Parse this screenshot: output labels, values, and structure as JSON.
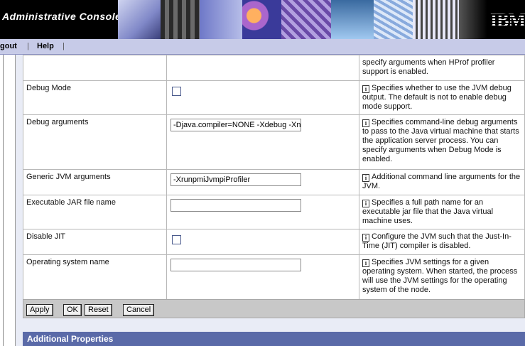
{
  "banner": {
    "title": "Administrative Console",
    "logo": "IBM"
  },
  "nav": {
    "items": [
      "gout",
      "Help"
    ]
  },
  "rows": [
    {
      "name": "",
      "type": "none",
      "value": "",
      "desc": "specify arguments when HProf profiler support is enabled.",
      "info": false
    },
    {
      "name": "Debug Mode",
      "type": "checkbox",
      "value": "",
      "desc": "Specifies whether to use the JVM debug output. The default is not to enable debug mode support.",
      "info": true
    },
    {
      "name": "Debug arguments",
      "type": "text",
      "value": "-Djava.compiler=NONE -Xdebug -Xnc",
      "desc": "Specifies command-line debug arguments to pass to the Java virtual machine that starts the application server process. You can specify arguments when Debug Mode is enabled.",
      "info": true
    },
    {
      "name": "Generic JVM arguments",
      "type": "text",
      "value": "-XrunpmiJvmpiProfiler",
      "desc": "Additional command line arguments for the JVM.",
      "info": true
    },
    {
      "name": "Executable JAR file name",
      "type": "text",
      "value": "",
      "desc": "Specifies a full path name for an executable jar file that the Java virtual machine uses.",
      "info": true
    },
    {
      "name": "Disable JIT",
      "type": "checkbox",
      "value": "",
      "desc": "Configure the JVM such that the Just-In-Time (JIT) compiler is disabled.",
      "info": true
    },
    {
      "name": "Operating system name",
      "type": "text",
      "value": "",
      "desc": "Specifies JVM settings for a given operating system. When started, the process will use the JVM settings for the operating system of the node.",
      "info": true
    }
  ],
  "buttons": {
    "apply": "Apply",
    "ok": "OK",
    "reset": "Reset",
    "cancel": "Cancel"
  },
  "section": {
    "additional": "Additional Properties"
  },
  "info_glyph": "i"
}
